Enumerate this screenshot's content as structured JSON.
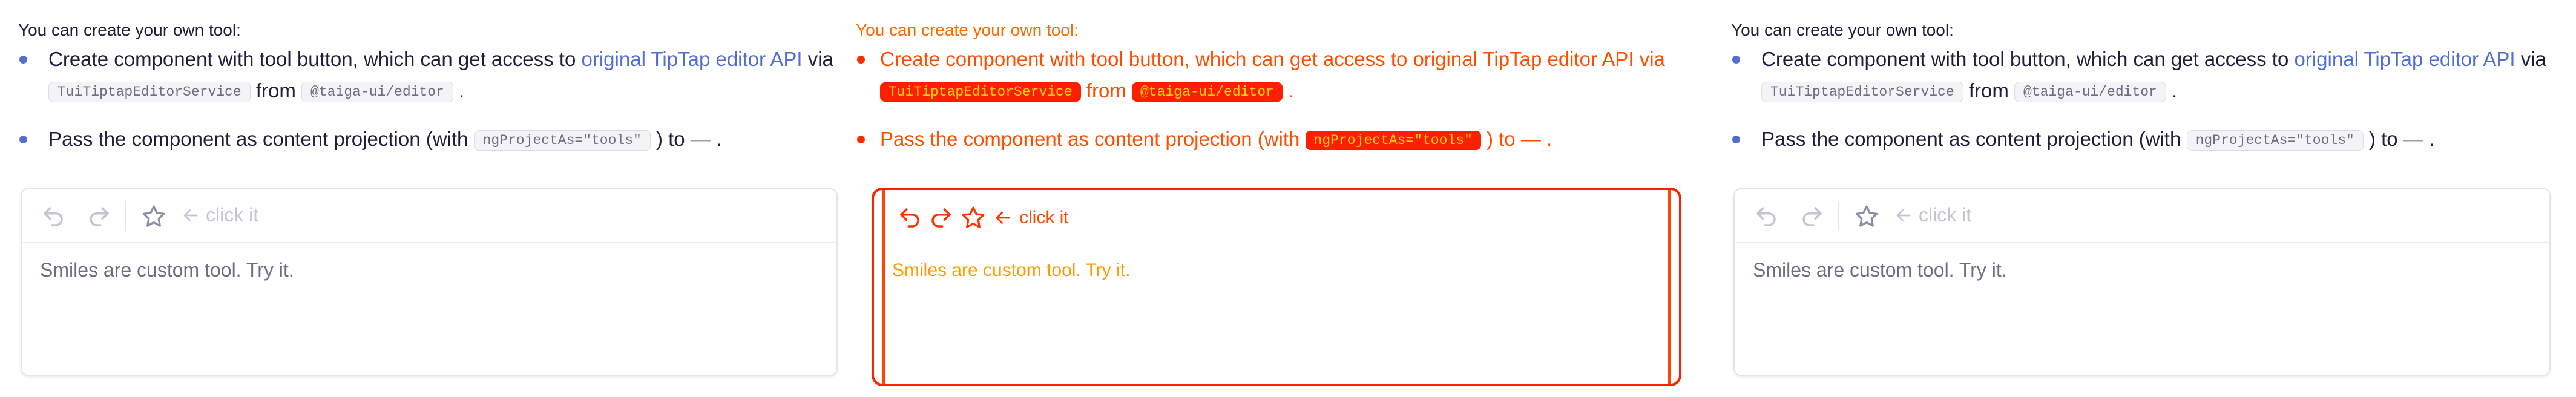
{
  "intro": "You can create your own tool:",
  "bullets": {
    "b1_part1": "Create component with tool button, which can get access to ",
    "b1_link": "original TipTap editor API",
    "b1_via": " via ",
    "b1_code1": "TuiTiptapEditorService",
    "b1_from": " from ",
    "b1_code2": "@taiga-ui/editor",
    "b1_end": " .",
    "b2_part1": "Pass the component as content projection (with ",
    "b2_code": "ngProjectAs=\"tools\"",
    "b2_part2": " ) to ",
    "b2_dash": "—",
    "b2_end": " ."
  },
  "editor": {
    "click_hint": "click it",
    "content": "Smiles are custom tool. Try it."
  },
  "icons": {
    "undo": "undo-icon",
    "redo": "redo-icon",
    "star": "star-icon",
    "arrow": "arrow-left-icon"
  },
  "colors": {
    "accent": "#526ed3",
    "text": "#1b1f3b",
    "muted": "#6b6f85",
    "border": "#e4e5ea",
    "diff_red": "#ff2200",
    "diff_orange": "#ff9a00"
  }
}
